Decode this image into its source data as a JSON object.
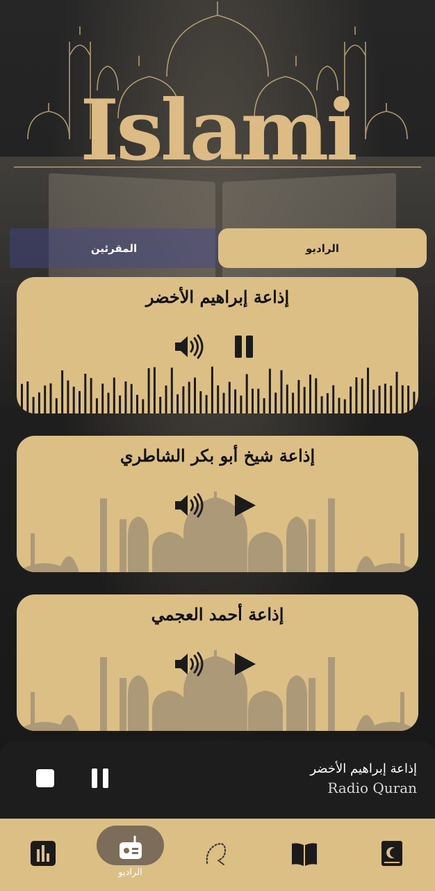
{
  "app": {
    "logo_text": "Islami"
  },
  "tabs": {
    "reciters": "المقرئين",
    "radio": "الراديو"
  },
  "stations": [
    {
      "name": "إذاعة إبراهيم الأخضر",
      "state": "playing"
    },
    {
      "name": "إذاعة شيخ أبو بكر الشاطري",
      "state": "paused"
    },
    {
      "name": "إذاعة أحمد العجمي",
      "state": "paused"
    }
  ],
  "player": {
    "station": "إذاعة إبراهيم الأخضر",
    "subtitle": "Radio Quran"
  },
  "nav": {
    "items": [
      {
        "icon": "stats-icon",
        "active": false
      },
      {
        "icon": "radio-icon",
        "active": true,
        "label": "الراديو"
      },
      {
        "icon": "prayer-beads-icon",
        "active": false
      },
      {
        "icon": "book-open-icon",
        "active": false
      },
      {
        "icon": "quran-icon",
        "active": false
      }
    ]
  },
  "colors": {
    "gold": "#dcbf85",
    "dark": "#1d1d1d",
    "active_pill": "#7b6d59"
  }
}
